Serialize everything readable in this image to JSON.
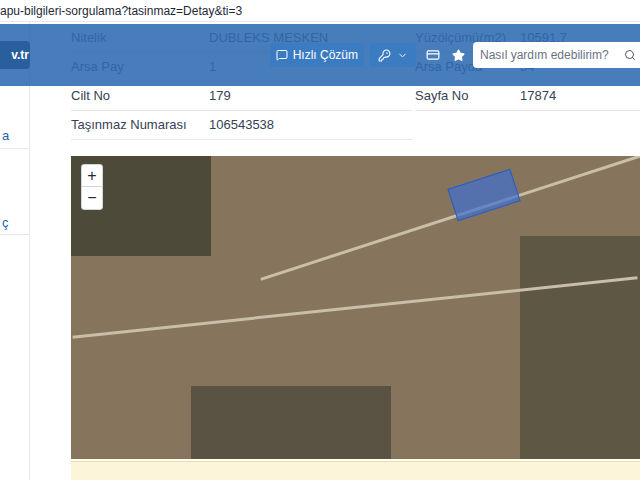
{
  "url": "apu-bilgileri-sorgulama?tasinmaz=Detay&ti=3",
  "header": {
    "logo": "v.tr",
    "buttons": [
      {
        "label": "Hızlı Çözüm"
      }
    ],
    "search": {
      "placeholder": "Nasıl yardım edebilirim?"
    }
  },
  "sidebar": {
    "items": [
      "a",
      "ç"
    ]
  },
  "table": {
    "rows": [
      [
        {
          "label": "Nitelik",
          "value": "DUBLEKS MESKEN"
        },
        {
          "label": "Yüzölçümü(m2)",
          "value": "10591,7"
        }
      ],
      [
        {
          "label": "Arsa Pay",
          "value": "1"
        },
        {
          "label": "Arsa Payda",
          "value": "34"
        }
      ],
      [
        {
          "label": "Cilt No",
          "value": "179"
        },
        {
          "label": "Sayfa No",
          "value": "17874"
        }
      ],
      [
        {
          "label": "Taşınmaz Numarası",
          "value": "106543538"
        }
      ]
    ]
  },
  "map": {
    "zoom_in": "+",
    "zoom_out": "−"
  }
}
